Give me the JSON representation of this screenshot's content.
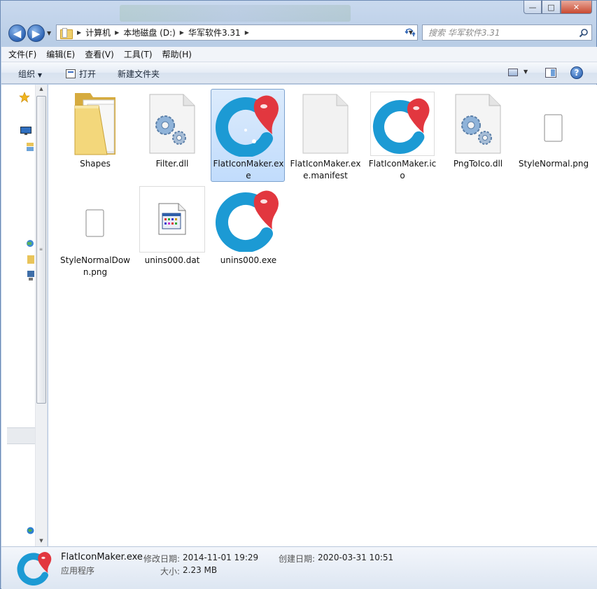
{
  "window": {
    "caption_buttons": {
      "minimize": "—",
      "maximize": "□",
      "close": "✕"
    }
  },
  "navigation": {
    "back": "◀",
    "forward": "▶",
    "breadcrumbs": [
      "计算机",
      "本地磁盘 (D:)",
      "华军软件3.31"
    ],
    "search_placeholder": "搜索 华军软件3.31"
  },
  "menu": {
    "items": [
      "文件(F)",
      "编辑(E)",
      "查看(V)",
      "工具(T)",
      "帮助(H)"
    ]
  },
  "toolbar": {
    "organize": "组织",
    "open": "打开",
    "new_folder": "新建文件夹",
    "help": "?"
  },
  "files": [
    {
      "name": "Shapes",
      "icon": "folder-icon",
      "selected": false
    },
    {
      "name": "Filter.dll",
      "icon": "dll-gear-icon",
      "selected": false
    },
    {
      "name": "FlatIconMaker.exe",
      "icon": "app-logo-icon",
      "selected": true
    },
    {
      "name": "FlatIconMaker.exe.manifest",
      "icon": "blank-document-icon",
      "selected": false
    },
    {
      "name": "FlatIconMaker.ico",
      "icon": "app-logo-icon",
      "selected": false
    },
    {
      "name": "PngToIco.dll",
      "icon": "dll-gear-icon",
      "selected": false
    },
    {
      "name": "StyleNormal.png",
      "icon": "small-image-icon",
      "selected": false
    },
    {
      "name": "StyleNormalDown.png",
      "icon": "small-image-icon",
      "selected": false
    },
    {
      "name": "unins000.dat",
      "icon": "dat-window-icon",
      "selected": false
    },
    {
      "name": "unins000.exe",
      "icon": "app-logo-icon",
      "selected": false
    }
  ],
  "details": {
    "name": "FlatIconMaker.exe",
    "type": "应用程序",
    "modified_label": "修改日期:",
    "modified_value": "2014-11-01 19:29",
    "created_label": "创建日期:",
    "created_value": "2020-03-31 10:51",
    "size_label": "大小:",
    "size_value": "2.23 MB"
  },
  "colors": {
    "selection": "#c1dcfc",
    "logo_blue": "#1f9fd8",
    "logo_red": "#e2373f"
  }
}
